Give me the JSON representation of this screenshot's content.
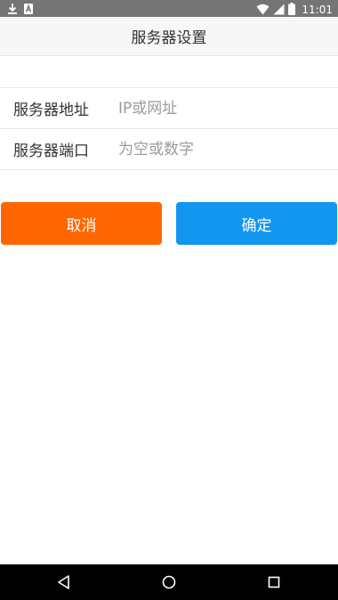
{
  "status_bar": {
    "time": "11:01",
    "icons": [
      "download-icon",
      "sim-notification-icon",
      "wifi-icon",
      "cell-signal-icon",
      "battery-icon"
    ]
  },
  "header": {
    "title": "服务器设置"
  },
  "form": {
    "address": {
      "label": "服务器地址",
      "placeholder": "IP或网址",
      "value": ""
    },
    "port": {
      "label": "服务器端口",
      "placeholder": "为空或数字",
      "value": ""
    }
  },
  "buttons": {
    "cancel_label": "取消",
    "confirm_label": "确定",
    "cancel_color": "#ff6600",
    "confirm_color": "#1296f0"
  },
  "nav_bar": {
    "icons": [
      "back-icon",
      "home-icon",
      "recents-icon"
    ]
  }
}
